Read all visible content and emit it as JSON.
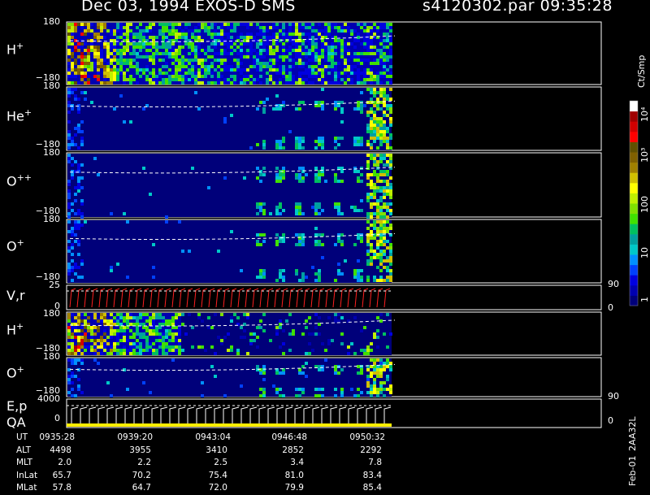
{
  "header": {
    "title_left": "Dec 03, 1994   EXOS-D SMS",
    "title_right": "s4120302.par  09:35:28"
  },
  "colorbar": {
    "unit_label": "Ct/Smp",
    "tick_labels": [
      "1",
      "10",
      "100",
      "10³",
      "10⁴"
    ],
    "colors": [
      "#00007a",
      "#0000b0",
      "#0000e0",
      "#0040ff",
      "#0090ff",
      "#00c8c8",
      "#00a0a0",
      "#00c060",
      "#40e000",
      "#80e000",
      "#c0f000",
      "#ffff00",
      "#d0c000",
      "#a08000",
      "#806000",
      "#605000",
      "#ff0000",
      "#d00000",
      "#a00000",
      "#ffffff"
    ]
  },
  "panels": [
    {
      "label": "H",
      "sup": "+",
      "y_top": "180",
      "y_bottom": "−180"
    },
    {
      "label": "He",
      "sup": "+",
      "y_top": "180",
      "y_bottom": "−180"
    },
    {
      "label": "O",
      "sup": "++",
      "y_top": "180",
      "y_bottom": "−180"
    },
    {
      "label": "O",
      "sup": "+",
      "y_top": "180",
      "y_bottom": "−180"
    },
    {
      "label": "V,r",
      "sup": "",
      "y_top": "25",
      "y_bottom": "0",
      "right_top": "90",
      "right_bottom": "0"
    },
    {
      "label": "H",
      "sup": "+",
      "y_top": "180",
      "y_bottom": "−180"
    },
    {
      "label": "O",
      "sup": "+",
      "y_top": "180",
      "y_bottom": "−180"
    },
    {
      "label": "E,p",
      "label2": "QA",
      "sup": "",
      "y_top": "4000",
      "y_bottom": "0",
      "right_top": "90",
      "right_bottom": "0"
    }
  ],
  "ephemeris": {
    "labels": [
      "UT",
      "ALT",
      "MLT",
      "InLat",
      "MLat"
    ],
    "columns": [
      {
        "UT": "0935:28",
        "ALT": "4498",
        "MLT": "2.0",
        "InLat": "65.7",
        "MLat": "57.8"
      },
      {
        "UT": "0939:20",
        "ALT": "3955",
        "MLT": "2.2",
        "InLat": "70.2",
        "MLat": "64.7"
      },
      {
        "UT": "0943:04",
        "ALT": "3410",
        "MLT": "2.5",
        "InLat": "75.4",
        "MLat": "72.0"
      },
      {
        "UT": "0946:48",
        "ALT": "2852",
        "MLT": "3.4",
        "InLat": "81.0",
        "MLat": "79.9"
      },
      {
        "UT": "0950:32",
        "ALT": "2292",
        "MLT": "7.8",
        "InLat": "83.4",
        "MLat": "85.4"
      }
    ]
  },
  "footer": {
    "date_code": "Feb-01",
    "id_code": "2AA32L"
  },
  "chart_data": {
    "type": "heatmap",
    "title": "Dec 03, 1994   EXOS-D SMS",
    "subtitle": "s4120302.par  09:35:28",
    "x_ticks": [
      "0935:28",
      "0939:20",
      "0943:04",
      "0946:48",
      "0950:32"
    ],
    "colorbar_scale": "log",
    "colorbar_range": [
      1,
      10000
    ],
    "colorbar_unit": "Ct/Smp",
    "series": [
      {
        "name": "H+",
        "ylim": [
          -180,
          180
        ]
      },
      {
        "name": "He+",
        "ylim": [
          -180,
          180
        ]
      },
      {
        "name": "O++",
        "ylim": [
          -180,
          180
        ]
      },
      {
        "name": "O+",
        "ylim": [
          -180,
          180
        ]
      },
      {
        "name": "V,r",
        "ylim": [
          0,
          25
        ],
        "right_ylim": [
          0,
          90
        ]
      },
      {
        "name": "H+",
        "ylim": [
          -180,
          180
        ]
      },
      {
        "name": "O+",
        "ylim": [
          -180,
          180
        ]
      },
      {
        "name": "E,p",
        "ylim": [
          0,
          4000
        ],
        "right_ylim": [
          0,
          90
        ]
      }
    ]
  }
}
